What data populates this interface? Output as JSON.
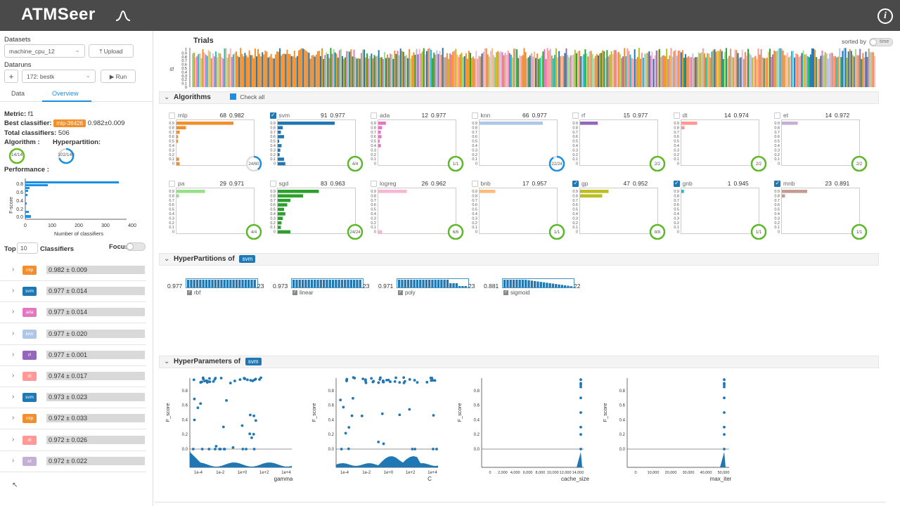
{
  "app": {
    "title": "ATMSeer"
  },
  "sidebar": {
    "datasets_label": "Datasets",
    "dataset_value": "machine_cpu_12",
    "upload_label": "Upload",
    "dataruns_label": "Dataruns",
    "datarun_value": "172: bestk",
    "run_label": "Run",
    "tabs": [
      "Data",
      "Overview"
    ],
    "metric_label": "Metric:",
    "metric_value": "f1",
    "best_label": "Best classifier:",
    "best_badge": "mlp-36426",
    "best_score": "0.982±0.009",
    "total_label": "Total classifiers:",
    "total_value": "506",
    "algorithm_label": "Algorithm :",
    "algorithm_progress": "14/14",
    "hyperpartition_label": "Hyperpartition:",
    "hyperpartition_progress": "102/140",
    "performance_label": "Performance :",
    "perf_ylabel": "F-score",
    "perf_xlabel": "Number of classifiers",
    "perf_xticks": [
      "0",
      "100",
      "200",
      "300",
      "400"
    ],
    "perf_yticks": [
      "0.8",
      "0.6",
      "0.4",
      "0.2",
      "0.0"
    ],
    "top_label": "Top",
    "top_value": "10",
    "classifiers_label": "Classifiers",
    "focus_label": "Focus:",
    "top_classifiers": [
      {
        "tag": "mlp",
        "color": "#f28e2b",
        "score": "0.982 ± 0.009"
      },
      {
        "tag": "svm",
        "color": "#1f77b4",
        "score": "0.977 ± 0.014"
      },
      {
        "tag": "ada",
        "color": "#e377c2",
        "score": "0.977 ± 0.014"
      },
      {
        "tag": "knn",
        "color": "#aec7e8",
        "score": "0.977 ± 0.020"
      },
      {
        "tag": "rf",
        "color": "#9467bd",
        "score": "0.977 ± 0.001"
      },
      {
        "tag": "dt",
        "color": "#ff9896",
        "score": "0.974 ± 0.017"
      },
      {
        "tag": "svm",
        "color": "#1f77b4",
        "score": "0.973 ± 0.023"
      },
      {
        "tag": "mlp",
        "color": "#f28e2b",
        "score": "0.972 ± 0.033"
      },
      {
        "tag": "dt",
        "color": "#ff9896",
        "score": "0.972 ± 0.026"
      },
      {
        "tag": "et",
        "color": "#c5b0d5",
        "score": "0.972 ± 0.022"
      }
    ]
  },
  "trials": {
    "title": "Trials",
    "sorted_by_label": "sorted by",
    "toggle_label": "time",
    "ylabel": "f1",
    "yticks": [
      "1",
      "0.9",
      "0.8",
      "0.7",
      "0.6",
      "0.5",
      "0.4",
      "0.3",
      "0.2",
      "0.1",
      "0"
    ]
  },
  "algorithms_section": {
    "title": "Algorithms",
    "check_all_label": "Check all",
    "yticks": [
      "0.9",
      "0.8",
      "0.7",
      "0.6",
      "0.5",
      "0.4",
      "0.3",
      "0.2",
      "0.1",
      "0"
    ],
    "items": [
      {
        "name": "mlp",
        "count": "68",
        "score": "0.982",
        "checked": false,
        "color": "#f28e2b",
        "progress": "24/60",
        "bars": [
          0.9,
          0.15,
          0.05,
          0.02,
          0.02,
          0,
          0,
          0,
          0.04,
          0.05
        ]
      },
      {
        "name": "svm",
        "count": "91",
        "score": "0.977",
        "checked": true,
        "color": "#1f77b4",
        "progress": "4/4",
        "bars": [
          0.9,
          0.08,
          0.05,
          0.1,
          0.02,
          0.06,
          0.04,
          0.03,
          0.1,
          0.12
        ]
      },
      {
        "name": "ada",
        "count": "12",
        "score": "0.977",
        "checked": false,
        "color": "#e377c2",
        "progress": "1/1",
        "bars": [
          0.12,
          0.06,
          0.04,
          0.05,
          0.02,
          0.04,
          0,
          0,
          0,
          0
        ]
      },
      {
        "name": "knn",
        "count": "66",
        "score": "0.977",
        "checked": false,
        "color": "#aec7e8",
        "progress": "22/24",
        "bars": [
          1.0,
          0,
          0,
          0,
          0,
          0,
          0,
          0,
          0,
          0
        ]
      },
      {
        "name": "rf",
        "count": "15",
        "score": "0.977",
        "checked": false,
        "color": "#9467bd",
        "progress": "2/2",
        "bars": [
          0.28,
          0,
          0,
          0,
          0,
          0,
          0,
          0,
          0,
          0
        ]
      },
      {
        "name": "dt",
        "count": "14",
        "score": "0.974",
        "checked": false,
        "color": "#ff9896",
        "progress": "2/2",
        "bars": [
          0.25,
          0.05,
          0,
          0,
          0,
          0,
          0,
          0,
          0,
          0
        ]
      },
      {
        "name": "et",
        "count": "14",
        "score": "0.972",
        "checked": false,
        "color": "#c5b0d5",
        "progress": "2/2",
        "bars": [
          0.25,
          0,
          0,
          0,
          0,
          0,
          0,
          0,
          0,
          0
        ]
      },
      {
        "name": "pa",
        "count": "29",
        "score": "0.971",
        "checked": false,
        "color": "#98df8a",
        "progress": "4/4",
        "bars": [
          0.45,
          0.04,
          0,
          0,
          0,
          0,
          0,
          0,
          0,
          0
        ]
      },
      {
        "name": "sgd",
        "count": "83",
        "score": "0.963",
        "checked": false,
        "color": "#2ca02c",
        "progress": "24/24",
        "bars": [
          0.65,
          0.4,
          0.2,
          0.15,
          0.1,
          0.12,
          0.08,
          0.06,
          0.05,
          0.2
        ]
      },
      {
        "name": "logreg",
        "count": "26",
        "score": "0.962",
        "checked": false,
        "color": "#f7b6d2",
        "progress": "6/6",
        "bars": [
          0.45,
          0,
          0,
          0,
          0,
          0,
          0,
          0,
          0,
          0.06
        ]
      },
      {
        "name": "bnb",
        "count": "17",
        "score": "0.957",
        "checked": false,
        "color": "#ffbb78",
        "progress": "1/1",
        "bars": [
          0.25,
          0,
          0,
          0,
          0,
          0,
          0,
          0,
          0,
          0
        ]
      },
      {
        "name": "gp",
        "count": "47",
        "score": "0.952",
        "checked": true,
        "color": "#bcbd22",
        "progress": "8/8",
        "bars": [
          0.45,
          0.35,
          0,
          0,
          0,
          0,
          0,
          0,
          0,
          0
        ]
      },
      {
        "name": "gnb",
        "count": "1",
        "score": "0.945",
        "checked": true,
        "color": "#17becf",
        "progress": "1/1",
        "bars": [
          0.04,
          0,
          0,
          0,
          0,
          0,
          0,
          0,
          0,
          0
        ]
      },
      {
        "name": "mnb",
        "count": "23",
        "score": "0.891",
        "checked": true,
        "color": "#c49c94",
        "progress": "1/1",
        "bars": [
          0.4,
          0.05,
          0,
          0,
          0,
          0,
          0,
          0,
          0,
          0
        ]
      }
    ]
  },
  "hyperpartitions_section": {
    "title": "HyperPartitions of",
    "badge": "svm",
    "items": [
      {
        "score": "0.977",
        "count": "23",
        "name": "rbf",
        "fill": 1.0
      },
      {
        "score": "0.973",
        "count": "23",
        "name": "linear",
        "fill": 1.0
      },
      {
        "score": "0.971",
        "count": "23",
        "name": "poly",
        "fill": 0.75
      },
      {
        "score": "0.881",
        "count": "22",
        "name": "sigmoid",
        "fill": 0.6
      }
    ]
  },
  "hyperparameters_section": {
    "title": "HyperParameters of",
    "badge": "svm",
    "plots": [
      {
        "param": "gamma",
        "ylabel": "F_score",
        "xticks": [
          "1e-4",
          "1e-2",
          "1e+0",
          "1e+2",
          "1e+4"
        ]
      },
      {
        "param": "C",
        "ylabel": "F_score",
        "xticks": [
          "1e-4",
          "1e-2",
          "1e+0",
          "1e+2",
          "1e+4"
        ]
      },
      {
        "param": "cache_size",
        "ylabel": "F_score",
        "xticks": [
          "0",
          "2,000",
          "4,000",
          "6,000",
          "8,000",
          "10,000",
          "12,000",
          "14,000"
        ]
      },
      {
        "param": "max_iter",
        "ylabel": "F_score",
        "xticks": [
          "0",
          "10,000",
          "20,000",
          "30,000",
          "40,000",
          "50,000"
        ]
      }
    ],
    "yticks": [
      "0.8",
      "0.6",
      "0.4",
      "0.2",
      "0.0"
    ]
  }
}
